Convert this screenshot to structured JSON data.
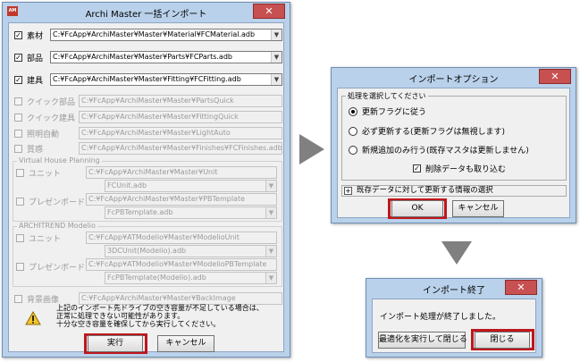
{
  "main": {
    "title": "Archi Master 一括インポート",
    "app_icon": "AM",
    "rows": [
      {
        "label": "素材",
        "path": "C:¥FcApp¥ArchiMaster¥Master¥Material¥FCMaterial.adb",
        "checked": true
      },
      {
        "label": "部品",
        "path": "C:¥FcApp¥ArchiMaster¥Master¥Parts¥FCParts.adb",
        "checked": true
      },
      {
        "label": "建具",
        "path": "C:¥FcApp¥ArchiMaster¥Master¥Fitting¥FCFitting.adb",
        "checked": true
      },
      {
        "label": "クイック部品",
        "path": "C:¥FcApp¥ArchiMaster¥Master¥PartsQuick"
      },
      {
        "label": "クイック建具",
        "path": "C:¥FcApp¥ArchiMaster¥Master¥FittingQuick"
      },
      {
        "label": "照明自動",
        "path": "C:¥FcApp¥ArchiMaster¥Master¥LightAuto"
      },
      {
        "label": "質感",
        "path": "C:¥FcApp¥ArchiMaster¥Master¥Finishes¥FCFinishes.adb"
      }
    ],
    "vhp": {
      "title": "Virtual House Planning",
      "unit_label": "ユニット",
      "unit_path": "C:¥FcApp¥ArchiMaster¥Master¥Unit",
      "unit_file": "FCUnit.adb",
      "pres_label": "プレゼンボード",
      "pres_path": "C:¥FcApp¥ArchiMaster¥Master¥PBTemplate",
      "pres_file": "FcPBTemplate.adb"
    },
    "atm": {
      "title": "ARCHITREND Modelio",
      "unit_label": "ユニット",
      "unit_path": "C:¥FcApp¥ATModelio¥Master¥ModelioUnit",
      "unit_file": "3DCUnit(Modelio).adb",
      "pres_label": "プレゼンボード",
      "pres_path": "C:¥FcApp¥ATModelio¥Master¥ModelioPBTemplate",
      "pres_file": "FcPBTemplate(Modelio).adb"
    },
    "bg_label": "背景画像",
    "bg_path": "C:¥FcApp¥ArchiMaster¥Master¥BackImage",
    "warning": [
      "上記のインポート先ドライブの空き容量が不足している場合は、",
      "正常に処理できない可能性があります。",
      "十分な空き容量を確保してから実行してください。"
    ],
    "run_label": "実行",
    "cancel_label": "キャンセル"
  },
  "options": {
    "title": "インポートオプション",
    "group_title": "処理を選択してください",
    "radios": [
      "更新フラグに従う",
      "必ず更新する(更新フラグは無視します)",
      "新規追加のみ行う(既存マスタは更新しません)"
    ],
    "delete_label": "削除データも取り込む",
    "expand_label": "既存データに対して更新する情報の選択",
    "ok_label": "OK",
    "cancel_label": "キャンセル"
  },
  "done": {
    "title": "インポート終了",
    "message": "インポート処理が終了しました。",
    "optimize_label": "最適化を実行して閉じる",
    "close_label": "閉じる"
  },
  "colors": {
    "frame": "#b9d1ea",
    "highlight": "#c0161c",
    "flow_arrow": "#808080"
  }
}
